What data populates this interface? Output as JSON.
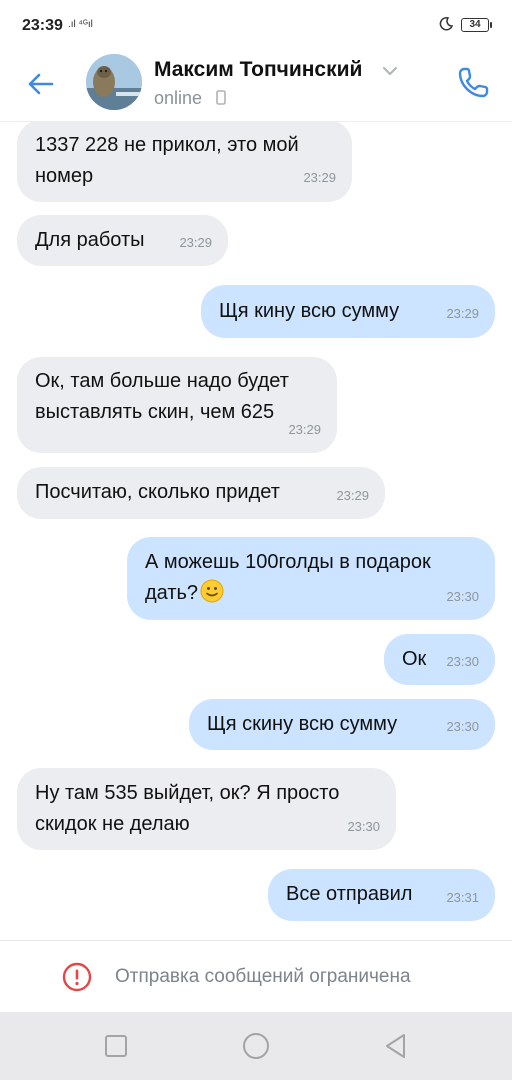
{
  "status_bar": {
    "time": "23:39",
    "signal": ".ıl ⁴ᴳıl",
    "battery": "34"
  },
  "header": {
    "name": "Максим Топчинский",
    "status": "online",
    "accent_color": "#3f8ae0"
  },
  "messages": [
    {
      "direction": "in",
      "text": "1337 228 не прикол, это мой\nномер",
      "time": "23:29"
    },
    {
      "direction": "in",
      "text": "Для работы",
      "time": "23:29"
    },
    {
      "direction": "out",
      "text": "Щя кину всю сумму",
      "time": "23:29"
    },
    {
      "direction": "in",
      "text": "Ок, там больше надо будет\nвыставлять скин, чем 625",
      "time": "23:29"
    },
    {
      "direction": "in",
      "text": "Посчитаю, сколько придет",
      "time": "23:29"
    },
    {
      "direction": "out",
      "text": "А можешь 100голды в подарок\nдать?",
      "emoji": "slightly-smiling-face",
      "time": "23:30"
    },
    {
      "direction": "out",
      "text": "Ок",
      "time": "23:30"
    },
    {
      "direction": "out",
      "text": "Щя скину всю сумму",
      "time": "23:30"
    },
    {
      "direction": "in",
      "text": "Ну там 535 выйдет, ок? Я просто\nскидок не делаю",
      "time": "23:30"
    },
    {
      "direction": "out",
      "text": "Все отправил",
      "time": "23:31"
    }
  ],
  "restriction": {
    "text": "Отправка сообщений ограничена",
    "icon": "alert-circle-icon",
    "color": "#e64646"
  },
  "colors": {
    "incoming_bubble": "#ebedf0",
    "outgoing_bubble": "#cce4ff"
  }
}
